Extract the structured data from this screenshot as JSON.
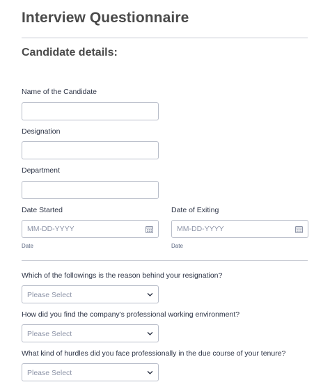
{
  "form": {
    "title": "Interview Questionnaire",
    "section_title": "Candidate details:"
  },
  "fields": {
    "candidate_name": {
      "label": "Name of the Candidate",
      "value": ""
    },
    "designation": {
      "label": "Designation",
      "value": ""
    },
    "department": {
      "label": "Department",
      "value": ""
    },
    "date_started": {
      "label": "Date Started",
      "placeholder": "MM-DD-YYYY",
      "sublabel": "Date",
      "icon": "calendar-icon"
    },
    "date_exiting": {
      "label": "Date of Exiting",
      "placeholder": "MM-DD-YYYY",
      "sublabel": "Date",
      "icon": "calendar-icon"
    }
  },
  "questions": [
    {
      "label": "Which of the followings is the reason behind your resignation?",
      "selected": "Please Select"
    },
    {
      "label": "How did you find the company's professional working environment?",
      "selected": "Please Select"
    },
    {
      "label": "What kind of hurdles did you face professionally in the due course of your tenure?",
      "selected": "Please Select"
    }
  ],
  "colors": {
    "title": "#4a4a4a",
    "border": "#b8bdc9",
    "placeholder": "#8e95a8",
    "divider": "#c7cad3"
  }
}
